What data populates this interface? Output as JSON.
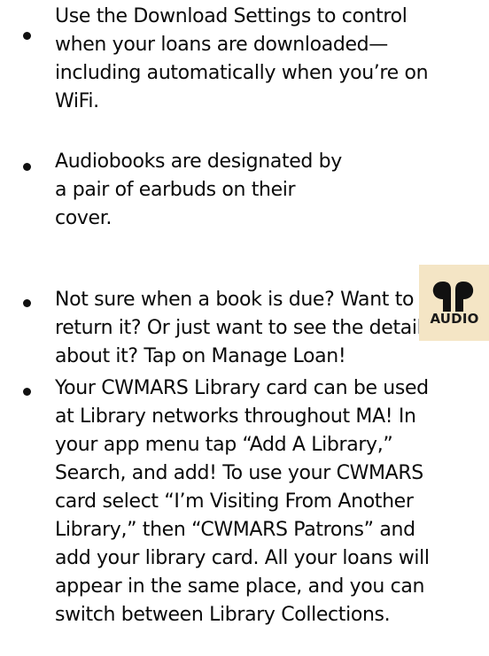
{
  "tips": [
    {
      "text": "Use the Download Settings to control\nwhen your loans are downloaded—\nincluding automatically when you’re on\nWiFi."
    },
    {
      "text": "Audiobooks are designated by\na pair of earbuds on their\ncover."
    },
    {
      "text": "Not sure when a book is due?  Want to\nreturn it?  Or just want to see the details\nabout it?  Tap on Manage Loan!"
    },
    {
      "text": "Your CWMARS Library card can be used\nat Library networks throughout MA!  In\nyour app menu tap “Add A Library,”\nSearch, and add!  To use your CWMARS\ncard select “I’m Visiting From Another\nLibrary,” then “CWMARS Patrons” and\nadd your library card.  All your loans will\nappear in the same place, and you can\nswitch between Library Collections."
    }
  ],
  "audio_badge": {
    "label": "AUDIO",
    "icon": "earbuds-icon",
    "background": "#f4e5c5"
  }
}
